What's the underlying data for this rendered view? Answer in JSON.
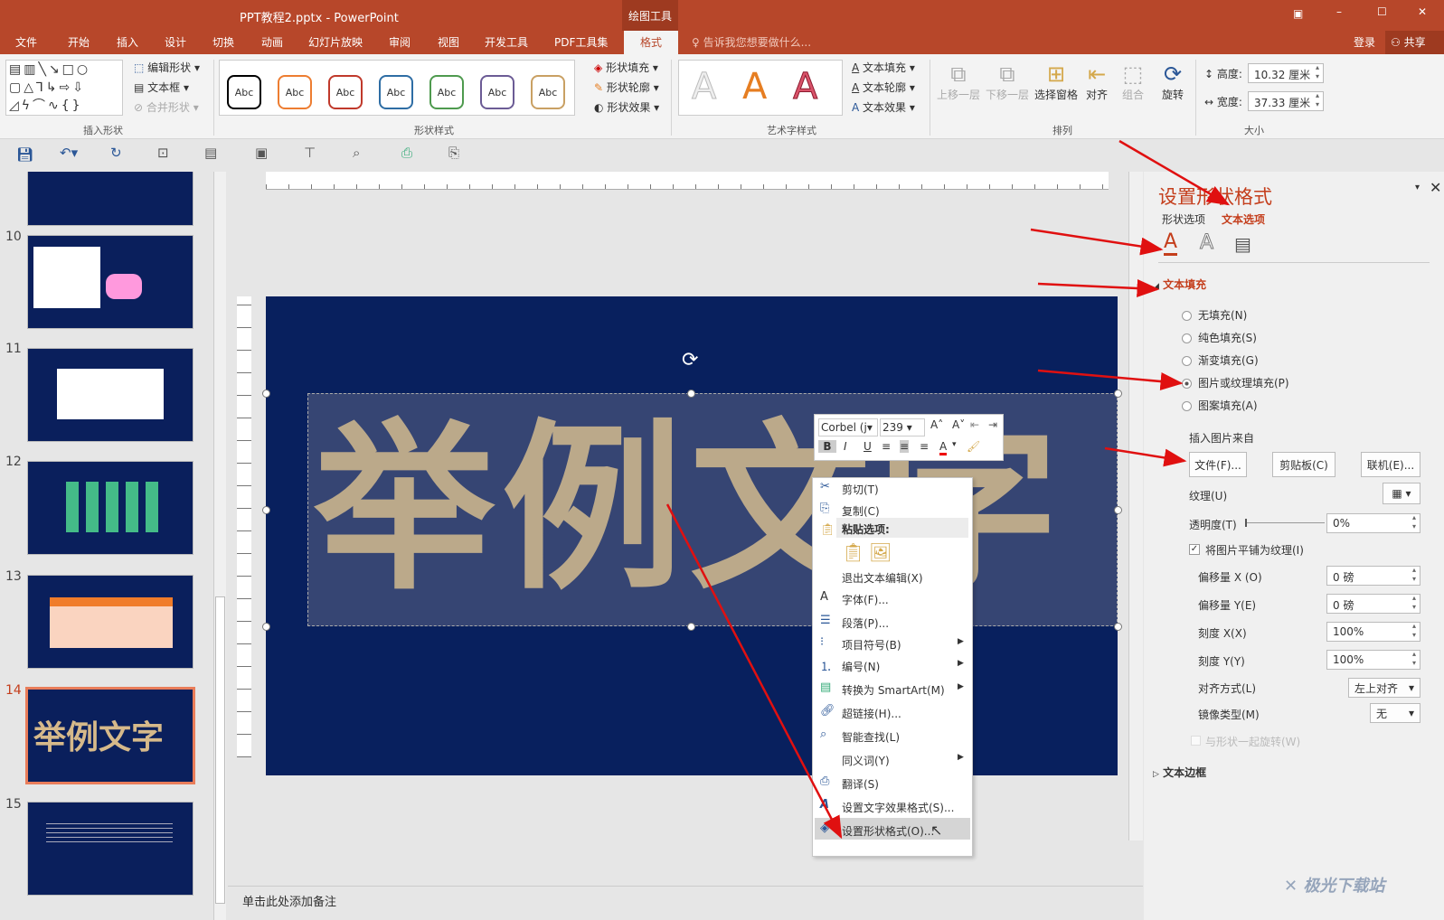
{
  "window": {
    "title": "PPT教程2.pptx - PowerPoint",
    "context_tab": "绘图工具",
    "signin": "登录",
    "share": "共享"
  },
  "tabs": [
    "文件",
    "开始",
    "插入",
    "设计",
    "切换",
    "动画",
    "幻灯片放映",
    "审阅",
    "视图",
    "开发工具",
    "PDF工具集",
    "格式"
  ],
  "active_tab": "格式",
  "tell_me": "告诉我您想要做什么...",
  "ribbon": {
    "insert_shapes": {
      "label": "插入形状",
      "edit_shape": "编辑形状",
      "textbox": "文本框",
      "merge": "合并形状"
    },
    "shape_styles": {
      "label": "形状样式",
      "sample": "Abc",
      "colors": [
        "#000000",
        "#ed7d31",
        "#c0392b",
        "#2e6da4",
        "#4e9a4e",
        "#6b5b95",
        "#c9a063"
      ],
      "fill": "形状填充",
      "outline": "形状轮廓",
      "effects": "形状效果"
    },
    "wordart": {
      "label": "艺术字样式",
      "sample": "A",
      "text_fill": "文本填充",
      "text_outline": "文本轮廓",
      "text_effects": "文本效果"
    },
    "arrange": {
      "label": "排列",
      "forward": "上移一层",
      "backward": "下移一层",
      "pane": "选择窗格",
      "align": "对齐",
      "group": "组合",
      "rotate": "旋转"
    },
    "size": {
      "label": "大小",
      "height_label": "高度:",
      "height": "10.32 厘米",
      "width_label": "宽度:",
      "width": "37.33 厘米"
    }
  },
  "thumbnails": [
    {
      "num": "10"
    },
    {
      "num": "11"
    },
    {
      "num": "12"
    },
    {
      "num": "13"
    },
    {
      "num": "14",
      "title": "举例文字",
      "selected": true
    },
    {
      "num": "15"
    }
  ],
  "slide": {
    "text": "举例文字",
    "bg": "#08205e"
  },
  "mini_toolbar": {
    "font": "Corbel (j",
    "size": "239",
    "bold": "B",
    "italic": "I",
    "underline": "U"
  },
  "context_menu": {
    "items": [
      {
        "label": "剪切(T)",
        "icon": "scissors-icon"
      },
      {
        "label": "复制(C)",
        "icon": "copy-icon"
      },
      {
        "label": "粘贴选项:",
        "icon": "paste-icon"
      },
      {
        "label": "退出文本编辑(X)"
      },
      {
        "label": "字体(F)...",
        "icon": "font-icon"
      },
      {
        "label": "段落(P)...",
        "icon": "paragraph-icon"
      },
      {
        "label": "项目符号(B)",
        "icon": "bullets-icon"
      },
      {
        "label": "编号(N)",
        "icon": "numbering-icon"
      },
      {
        "label": "转换为 SmartArt(M)",
        "icon": "smartart-icon"
      },
      {
        "label": "超链接(H)...",
        "icon": "link-icon"
      },
      {
        "label": "智能查找(L)",
        "icon": "search-icon"
      },
      {
        "label": "同义词(Y)"
      },
      {
        "label": "翻译(S)",
        "icon": "translate-icon"
      },
      {
        "label": "设置文字效果格式(S)...",
        "icon": "text-effect-icon"
      },
      {
        "label": "设置形状格式(O)...",
        "icon": "format-shape-icon"
      }
    ]
  },
  "panel": {
    "title": "设置形状格式",
    "tab_shape": "形状选项",
    "tab_text": "文本选项",
    "section": "文本填充",
    "fill_options": [
      "无填充(N)",
      "纯色填充(S)",
      "渐变填充(G)",
      "图片或纹理填充(P)",
      "图案填充(A)"
    ],
    "selected_fill": "图片或纹理填充(P)",
    "insert_from": "插入图片来自",
    "btn_file": "文件(F)...",
    "btn_clipboard": "剪贴板(C)",
    "btn_online": "联机(E)...",
    "texture": "纹理(U)",
    "transparency": "透明度(T)",
    "transparency_value": "0%",
    "tile": "将图片平铺为纹理(I)",
    "tile_checked": true,
    "offset_x": "偏移量 X (O)",
    "offset_x_value": "0 磅",
    "offset_y": "偏移量 Y(E)",
    "offset_y_value": "0 磅",
    "scale_x": "刻度 X(X)",
    "scale_x_value": "100%",
    "scale_y": "刻度 Y(Y)",
    "scale_y_value": "100%",
    "alignment": "对齐方式(L)",
    "alignment_value": "左上对齐",
    "mirror": "镜像类型(M)",
    "mirror_value": "无",
    "rotate_with": "与形状一起旋转(W)",
    "text_box_section": "文本边框"
  },
  "notes": "单击此处添加备注",
  "watermark": "极光下载站"
}
